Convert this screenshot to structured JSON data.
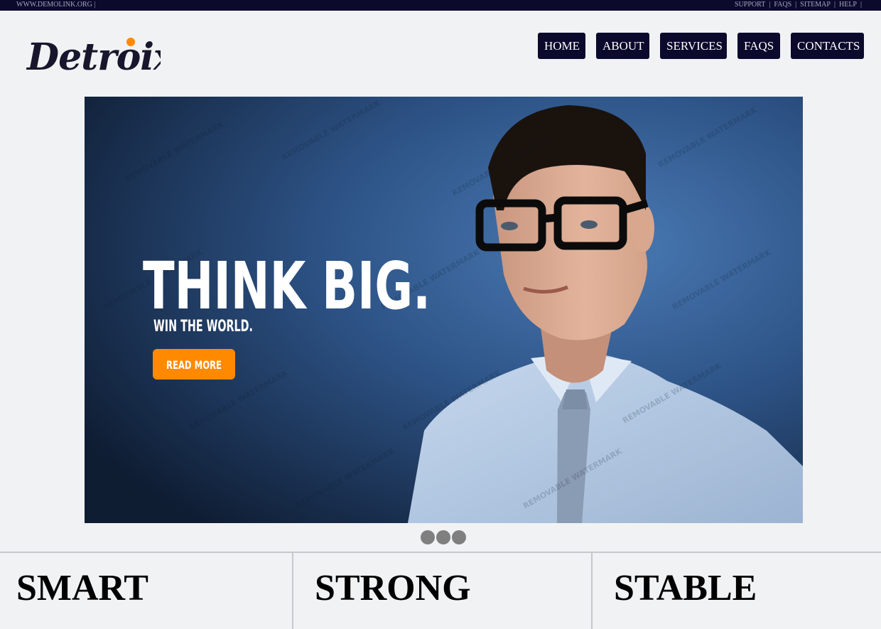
{
  "topbar": {
    "site_url": "WWW.DEMOLINK.ORG |",
    "links": [
      "SUPPORT",
      "FAQS",
      "SITEMAP",
      "HELP"
    ],
    "separator": "|"
  },
  "brand": {
    "name": "Detroix",
    "accent_color": "#ff8a00",
    "dark_color": "#0b0a2d"
  },
  "nav": {
    "items": [
      "HOME",
      "ABOUT",
      "SERVICES",
      "FAQS",
      "CONTACTS"
    ]
  },
  "slider": {
    "headline": "THINK BIG.",
    "subline": "WIN THE WORLD.",
    "cta_label": "READ MORE",
    "watermark": "REMOVABLE WATERMARK",
    "dots_count": 3
  },
  "features": [
    "SMART",
    "STRONG",
    "STABLE"
  ]
}
